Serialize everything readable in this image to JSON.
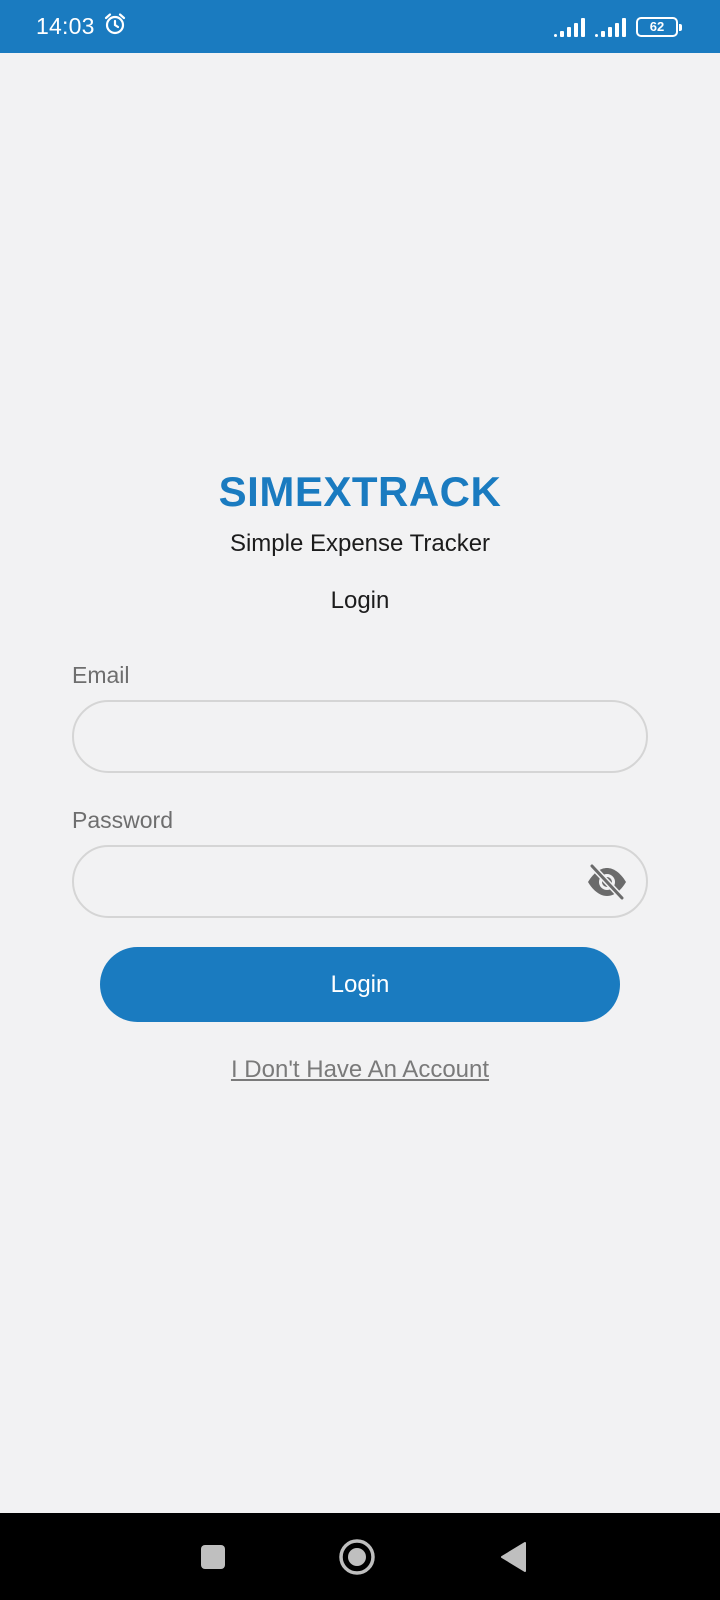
{
  "status_bar": {
    "time": "14:03",
    "battery": "62",
    "icons": [
      "alarm-icon",
      "signal-icon",
      "signal-icon",
      "battery-icon"
    ],
    "color": "#1a7bc0"
  },
  "app": {
    "brand": "SIMEXTRACK",
    "tagline": "Simple Expense Tracker",
    "heading": "Login",
    "brand_color": "#1a7bc0"
  },
  "form": {
    "email_label": "Email",
    "email_value": "",
    "password_label": "Password",
    "password_value": "",
    "password_toggle_icon": "eye-off-icon",
    "submit_label": "Login",
    "no_account_link": "I Don't Have An Account"
  },
  "nav_bar": {
    "buttons": [
      "recents-square-icon",
      "home-circle-icon",
      "back-triangle-icon"
    ]
  }
}
